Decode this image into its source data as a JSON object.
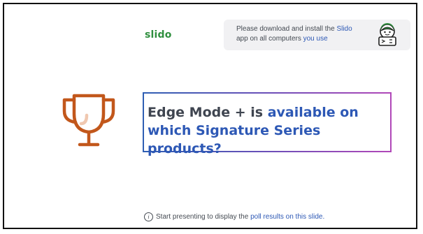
{
  "brand": {
    "logo_text": "slido"
  },
  "notice": {
    "line1_a": "Please download and install the ",
    "line1_b": "Slido",
    "line2_a": "app on all computers ",
    "line2_b": "you use",
    "avatar_icon": "slido-laptop-mascot-icon"
  },
  "trophy_icon": "trophy-icon",
  "question": {
    "part1": "Edge Mode + is ",
    "part2": "available on which Signature Series products?"
  },
  "footer": {
    "icon": "info-icon",
    "text_a": "Start presenting to display the ",
    "text_b": "poll results on this slide."
  },
  "colors": {
    "brand_green": "#2f8f3e",
    "accent_blue": "#2d58b5",
    "trophy_orange": "#c2571b",
    "gradient_start": "#2f5fb3",
    "gradient_end": "#b147b8"
  }
}
